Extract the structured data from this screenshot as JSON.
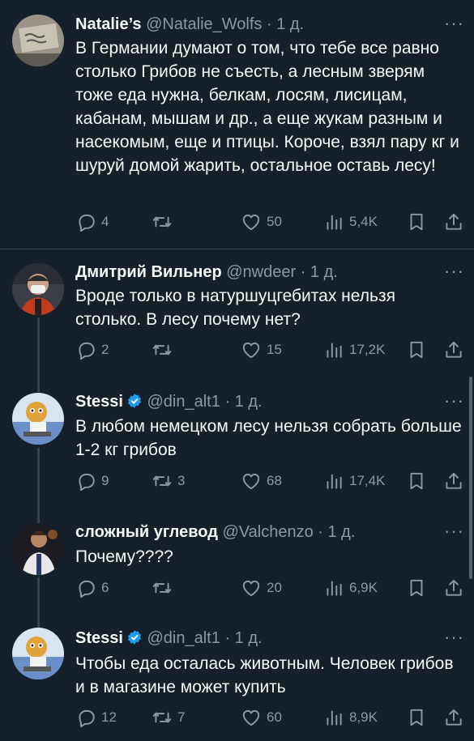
{
  "tweets": [
    {
      "name": "Natalie’s",
      "handle": "@Natalie_Wolfs",
      "dot": "·",
      "time": "1 д.",
      "verified": false,
      "text": "В Германии думают о том, что тебе все равно столько Грибов не съесть, а лесным зверям тоже еда нужна, белкам, лосям, лисицам, кабанам, мышам и др., а еще жукам разным и насекомым, еще и птицы. Короче, взял пару кг и шуруй домой жарить, остальное оставь лесу!",
      "replies": "4",
      "retweets": "",
      "likes": "50",
      "views": "5,4K"
    },
    {
      "name": "Дмитрий Вильнер",
      "handle": "@nwdeer",
      "dot": "·",
      "time": "1 д.",
      "verified": false,
      "text": "Вроде только в натуршуцгебитах нельзя столько. В лесу почему нет?",
      "replies": "2",
      "retweets": "",
      "likes": "15",
      "views": "17,2K"
    },
    {
      "name": "Stessi",
      "handle": "@din_alt1",
      "dot": "·",
      "time": "1 д.",
      "verified": true,
      "text": "В любом немецком лесу нельзя собрать больше 1-2 кг грибов",
      "replies": "9",
      "retweets": "3",
      "likes": "68",
      "views": "17,4K"
    },
    {
      "name": "сложный углевод",
      "handle": "@Valchenzo",
      "dot": "·",
      "time": "1 д.",
      "verified": false,
      "text": "Почему????",
      "replies": "6",
      "retweets": "",
      "likes": "20",
      "views": "6,9K"
    },
    {
      "name": "Stessi",
      "handle": "@din_alt1",
      "dot": "·",
      "time": "1 д.",
      "verified": true,
      "text": "Чтобы еда осталась животным. Человек грибов и в магазине может купить",
      "replies": "12",
      "retweets": "7",
      "likes": "60",
      "views": "8,9K"
    }
  ],
  "more_label": "···",
  "colors": {
    "background": "#15202b",
    "secondary_text": "#8b98a5",
    "verified": "#1d9bf0",
    "divider": "#38444d"
  }
}
